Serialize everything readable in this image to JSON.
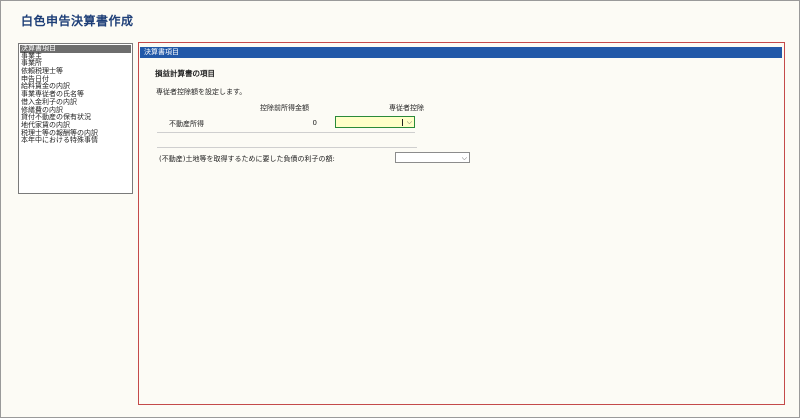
{
  "app": {
    "title": "白色申告決算書作成"
  },
  "sidebar": {
    "items": [
      {
        "label": "決算書項目",
        "selected": true
      },
      {
        "label": "事業主"
      },
      {
        "label": "事業所"
      },
      {
        "label": "依頼税理士等"
      },
      {
        "label": "申告日付"
      },
      {
        "label": "給料賃金の内訳"
      },
      {
        "label": "事業専従者の氏名等"
      },
      {
        "label": "借入金利子の内訳"
      },
      {
        "label": "修繕費の内訳"
      },
      {
        "label": "貸付不動産の保有状況"
      },
      {
        "label": "地代家賃の内訳"
      },
      {
        "label": "税理士等の報酬等の内訳"
      },
      {
        "label": "本年中における特殊事情"
      }
    ]
  },
  "main": {
    "header": "決算書項目",
    "section_title": "損益計算書の項目",
    "instruction": "専従者控除額を設定します。",
    "columns": {
      "pre_deduction": "控除前所得金額",
      "deduction": "専従者控除"
    },
    "row": {
      "label": "不動産所得",
      "amount": "0",
      "deduction_value": ""
    },
    "interest_label": "(不動産)土地等を取得するために要した負債の利子の額:",
    "interest_value": ""
  },
  "colors": {
    "accent": "#2158a8",
    "title": "#1e3f78",
    "main_border": "#c44a4a",
    "highlight_field": "#ffffc8"
  },
  "icons": {
    "dropdown": "chevron-down-icon"
  }
}
